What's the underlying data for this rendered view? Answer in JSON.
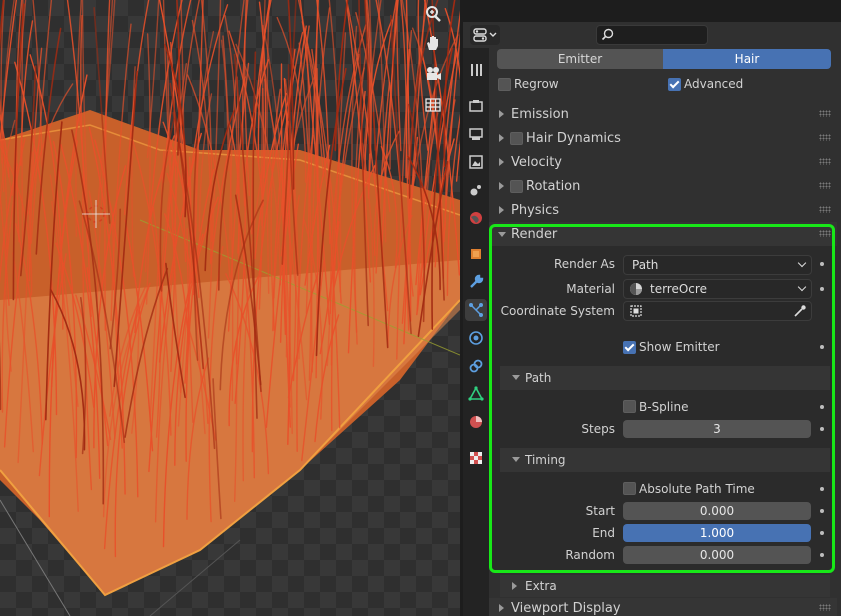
{
  "search": {
    "placeholder": ""
  },
  "type_toggle": {
    "emitter": "Emitter",
    "hair": "Hair",
    "active": "Hair"
  },
  "options": {
    "regrow": "Regrow",
    "regrow_checked": false,
    "advanced": "Advanced",
    "advanced_checked": true
  },
  "sections": [
    {
      "label": "Emission",
      "has_checkbox": false
    },
    {
      "label": "Hair Dynamics",
      "has_checkbox": true
    },
    {
      "label": "Velocity",
      "has_checkbox": false
    },
    {
      "label": "Rotation",
      "has_checkbox": true
    },
    {
      "label": "Physics",
      "has_checkbox": false
    }
  ],
  "render": {
    "label": "Render",
    "render_as_label": "Render As",
    "render_as_value": "Path",
    "material_label": "Material",
    "material_value": "terreOcre",
    "coord_label": "Coordinate System",
    "show_emitter": "Show Emitter",
    "show_emitter_checked": true,
    "path": {
      "label": "Path",
      "bspline": "B-Spline",
      "bspline_checked": false,
      "steps_label": "Steps",
      "steps_value": "3"
    },
    "timing": {
      "label": "Timing",
      "absolute": "Absolute Path Time",
      "absolute_checked": false,
      "start_label": "Start",
      "start_value": "0.000",
      "end_label": "End",
      "end_value": "1.000",
      "random_label": "Random",
      "random_value": "0.000"
    }
  },
  "extra": {
    "label": "Extra"
  },
  "viewport_display": {
    "label": "Viewport Display"
  },
  "colors": {
    "accent": "#4772b3",
    "highlight": "#18e818",
    "hair": "#e8502a"
  },
  "icons": {
    "viewport_tools": [
      "zoom-icon",
      "hand-icon",
      "camera-icon",
      "grid-icon"
    ],
    "property_tabs": [
      "tool-icon",
      "render-icon",
      "output-icon",
      "view-layer-icon",
      "scene-icon",
      "world-icon",
      "object-icon",
      "modifier-icon",
      "particles-icon",
      "physics-icon",
      "constraints-icon",
      "data-icon",
      "material-icon",
      "texture-icon"
    ]
  }
}
